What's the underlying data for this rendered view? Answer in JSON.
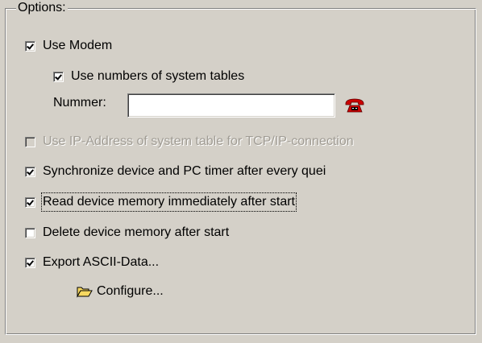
{
  "options": {
    "legend": "Options:",
    "use_modem": {
      "label": "Use Modem",
      "checked": true
    },
    "use_numbers": {
      "label": "Use numbers of system tables",
      "checked": true
    },
    "nummer": {
      "label": "Nummer:",
      "value": ""
    },
    "phone_icon": "phone-icon",
    "use_ip": {
      "label": "Use IP-Address of system table for TCP/IP-connection",
      "checked": false,
      "enabled": false
    },
    "sync_timer": {
      "label": "Synchronize device and PC timer after every quei",
      "checked": true
    },
    "read_memory": {
      "label": "Read device memory immediately after start",
      "checked": true
    },
    "delete_memory": {
      "label": "Delete device memory after start",
      "checked": false
    },
    "export_ascii": {
      "label": "Export ASCII-Data...",
      "checked": true
    },
    "configure": {
      "label": "Configure...",
      "icon": "folder-open-icon"
    }
  },
  "colors": {
    "background": "#d4d0c8",
    "disabled_text": "#a09c94",
    "phone_red": "#cc0000",
    "folder_yellow": "#f6d860"
  }
}
